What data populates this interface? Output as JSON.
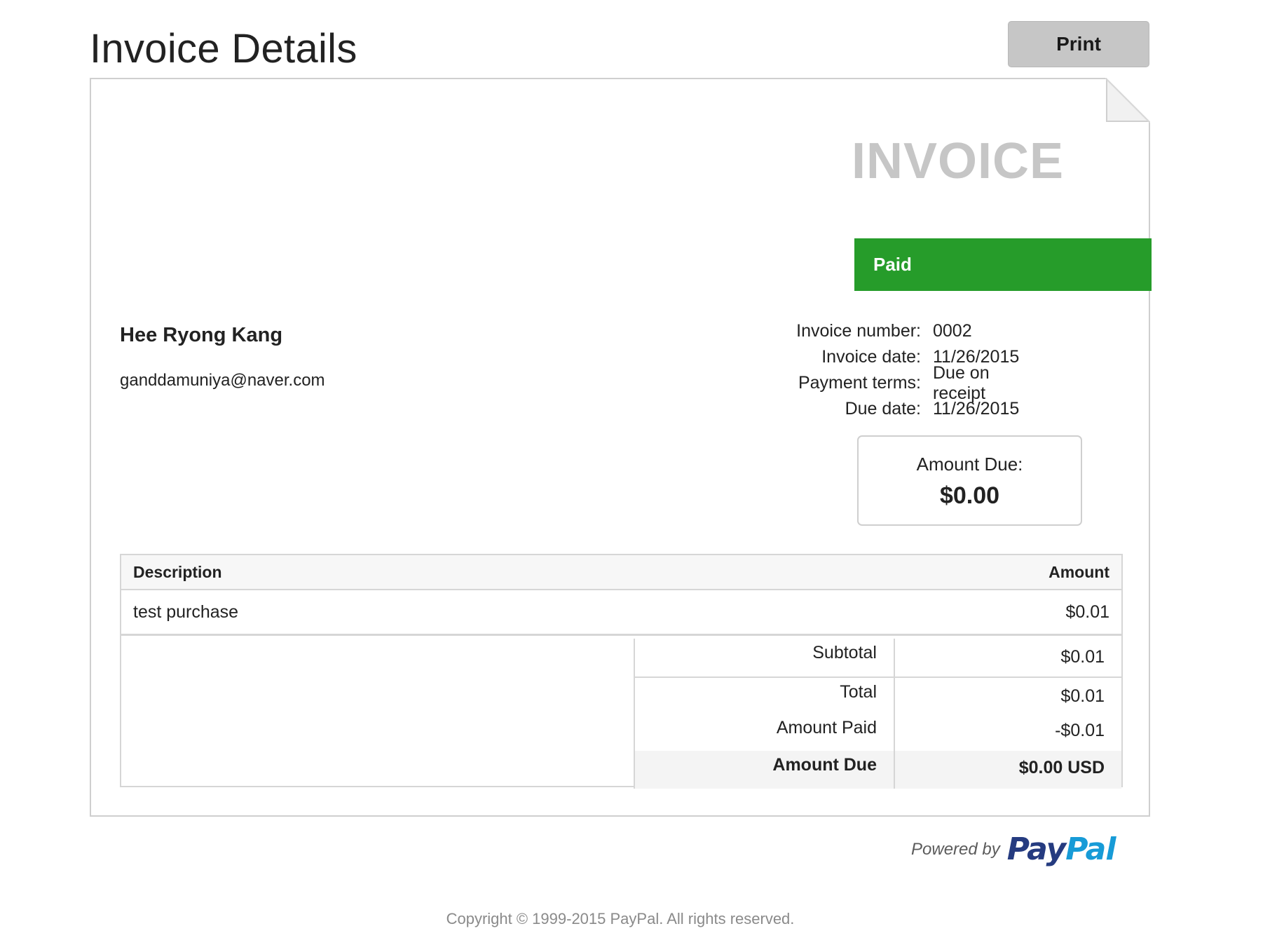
{
  "header": {
    "title": "Invoice Details",
    "print_label": "Print"
  },
  "invoice": {
    "heading": "INVOICE",
    "status": "Paid",
    "status_color": "#269c2a",
    "customer": {
      "name": "Hee Ryong Kang",
      "email": "ganddamuniya@naver.com"
    },
    "meta": [
      {
        "label": "Invoice number:",
        "value": "0002"
      },
      {
        "label": "Invoice date:",
        "value": "11/26/2015"
      },
      {
        "label": "Payment terms:",
        "value": "Due on receipt"
      },
      {
        "label": "Due date:",
        "value": "11/26/2015"
      }
    ],
    "amount_due_box": {
      "label": "Amount Due:",
      "value": "$0.00"
    },
    "items_table": {
      "columns": [
        "Description",
        "Amount"
      ],
      "rows": [
        {
          "description": "test purchase",
          "amount": "$0.01"
        }
      ]
    },
    "totals": [
      {
        "label": "Subtotal",
        "value": "$0.01"
      },
      {
        "label": "Total",
        "value": "$0.01"
      },
      {
        "label": "Amount Paid",
        "value": "-$0.01"
      },
      {
        "label": "Amount Due",
        "value": "$0.00 USD"
      }
    ]
  },
  "footer": {
    "powered_by": "Powered by",
    "logo_pay": "Pay",
    "logo_pal": "Pal",
    "copyright": "Copyright © 1999-2015 PayPal. All rights reserved."
  },
  "icons": {
    "corner_fold": "page-corner-fold-icon",
    "logo": "paypal-logo"
  }
}
